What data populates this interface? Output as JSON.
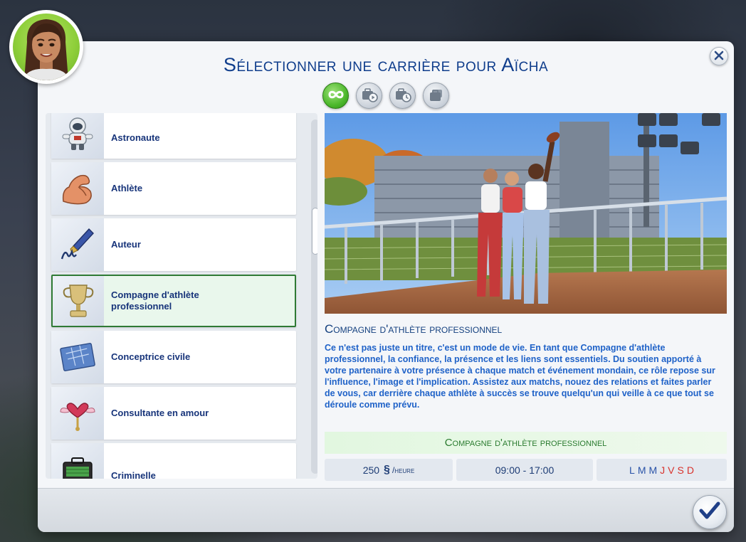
{
  "dialog": {
    "title": "Sélectionner une carrière pour Aïcha",
    "close_icon": "close-icon",
    "confirm_icon": "checkmark-icon"
  },
  "tabs": [
    {
      "icon": "infinity-icon",
      "active": true
    },
    {
      "icon": "part-time-job-icon",
      "active": false
    },
    {
      "icon": "clock-job-icon",
      "active": false
    },
    {
      "icon": "briefcase-stack-icon",
      "active": false
    }
  ],
  "careers": [
    {
      "label": "Astronaute",
      "icon": "astronaut-icon"
    },
    {
      "label": "Athlète",
      "icon": "flexed-arm-icon"
    },
    {
      "label": "Auteur",
      "icon": "fountain-pen-icon"
    },
    {
      "label": "Compagne d'athlète professionnel",
      "icon": "trophy-icon",
      "selected": true
    },
    {
      "label": "Conceptrice civile",
      "icon": "blueprint-icon"
    },
    {
      "label": "Consultante en amour",
      "icon": "winged-heart-icon"
    },
    {
      "label": "Criminelle",
      "icon": "money-briefcase-icon"
    }
  ],
  "detail": {
    "name": "Compagne d'athlète professionnel",
    "description": "Ce n'est pas juste un titre, c'est un mode de vie. En tant que Compagne d'athlète professionnel, la confiance, la présence et les liens sont essentiels. Du soutien apporté à votre partenaire à votre présence à chaque match et événement mondain, ce rôle repose sur l'influence, l'image et l'implication. Assistez aux matchs, nouez des relations et faites parler de vous, car derrière chaque athlète à succès se trouve quelqu'un qui veille à ce que tout se déroule comme prévu.",
    "summary_title": "Compagne d'athlète professionnel",
    "pay_amount": "250",
    "pay_currency": "§",
    "pay_unit": "/heure",
    "hours": "09:00 - 17:00",
    "days": [
      {
        "d": "L",
        "work": false
      },
      {
        "d": "M",
        "work": false
      },
      {
        "d": "M",
        "work": false
      },
      {
        "d": "J",
        "work": true
      },
      {
        "d": "V",
        "work": true
      },
      {
        "d": "S",
        "work": true
      },
      {
        "d": "D",
        "work": true
      }
    ]
  },
  "colors": {
    "title": "#0f3d8c",
    "label": "#17347a",
    "description": "#1f62c8",
    "summary_green": "#2a7b2f",
    "workday_red": "#d8322c",
    "offday_blue": "#2a53a8",
    "active_tab": "#4cb82c"
  }
}
